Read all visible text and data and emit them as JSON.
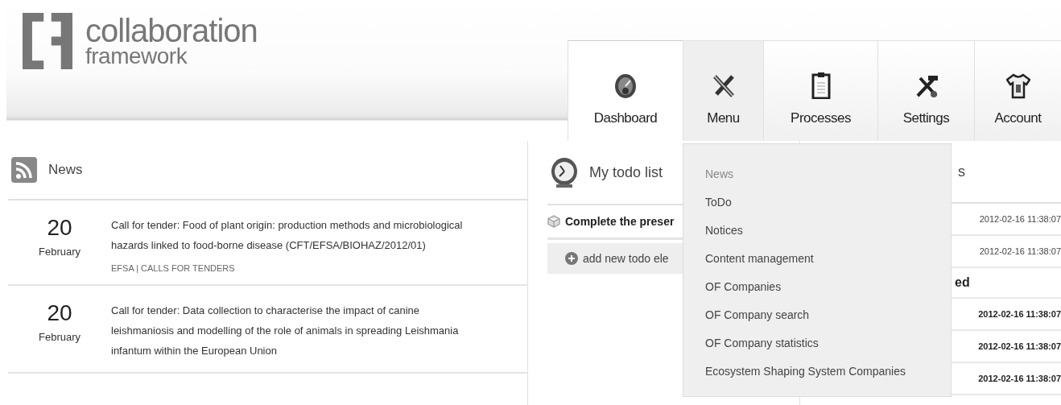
{
  "logo": {
    "line1": "collaboration",
    "line2": "framework"
  },
  "tabs": [
    {
      "label": "Dashboard",
      "kind": "dashboard",
      "selected": true,
      "open": false
    },
    {
      "label": "Menu",
      "kind": "tools",
      "selected": false,
      "open": true
    },
    {
      "label": "Processes",
      "kind": "clipboard",
      "selected": false,
      "open": false
    },
    {
      "label": "Settings",
      "kind": "wrench",
      "selected": false,
      "open": false
    },
    {
      "label": "Account",
      "kind": "shirt",
      "selected": false,
      "open": false
    }
  ],
  "menu_dropdown": {
    "items": [
      {
        "label": "News",
        "disabled": true
      },
      {
        "label": "ToDo",
        "disabled": false
      },
      {
        "label": "Notices",
        "disabled": false
      },
      {
        "label": "Content management",
        "disabled": false
      },
      {
        "label": "OF Companies",
        "disabled": false
      },
      {
        "label": "OF Company search",
        "disabled": false
      },
      {
        "label": "OF Company statistics",
        "disabled": false
      },
      {
        "label": "Ecosystem Shaping System Companies",
        "disabled": false
      }
    ]
  },
  "news": {
    "title": "News",
    "items": [
      {
        "day": "20",
        "month": "February",
        "title": "Call for tender: Food of plant origin: production methods and microbiological hazards linked to food-borne disease (CFT/EFSA/BIOHAZ/2012/01)",
        "source": "EFSA | CALLS FOR TENDERS"
      },
      {
        "day": "20",
        "month": "February",
        "title": "Call for tender: Data collection to characterise the impact of canine leishmaniosis and modelling of the role of animals in spreading Leishmania infantum within the European Union"
      }
    ]
  },
  "todo": {
    "title": "My todo list",
    "items": [
      "Complete the preser"
    ],
    "add_label": "add new todo ele"
  },
  "right_panel": {
    "title": "s",
    "sections": [
      {
        "rows": [
          {
            "time": "2012-02-16 11:38:07",
            "bold": false
          },
          {
            "time": "2012-02-16 11:38:07",
            "bold": false
          }
        ]
      },
      {
        "heading": "ed",
        "rows": [
          {
            "time": "2012-02-16 11:38:07",
            "bold": true
          },
          {
            "time": "2012-02-16 11:38:07",
            "bold": true
          },
          {
            "time": "2012-02-16 11:38:07",
            "bold": true
          }
        ]
      }
    ]
  }
}
